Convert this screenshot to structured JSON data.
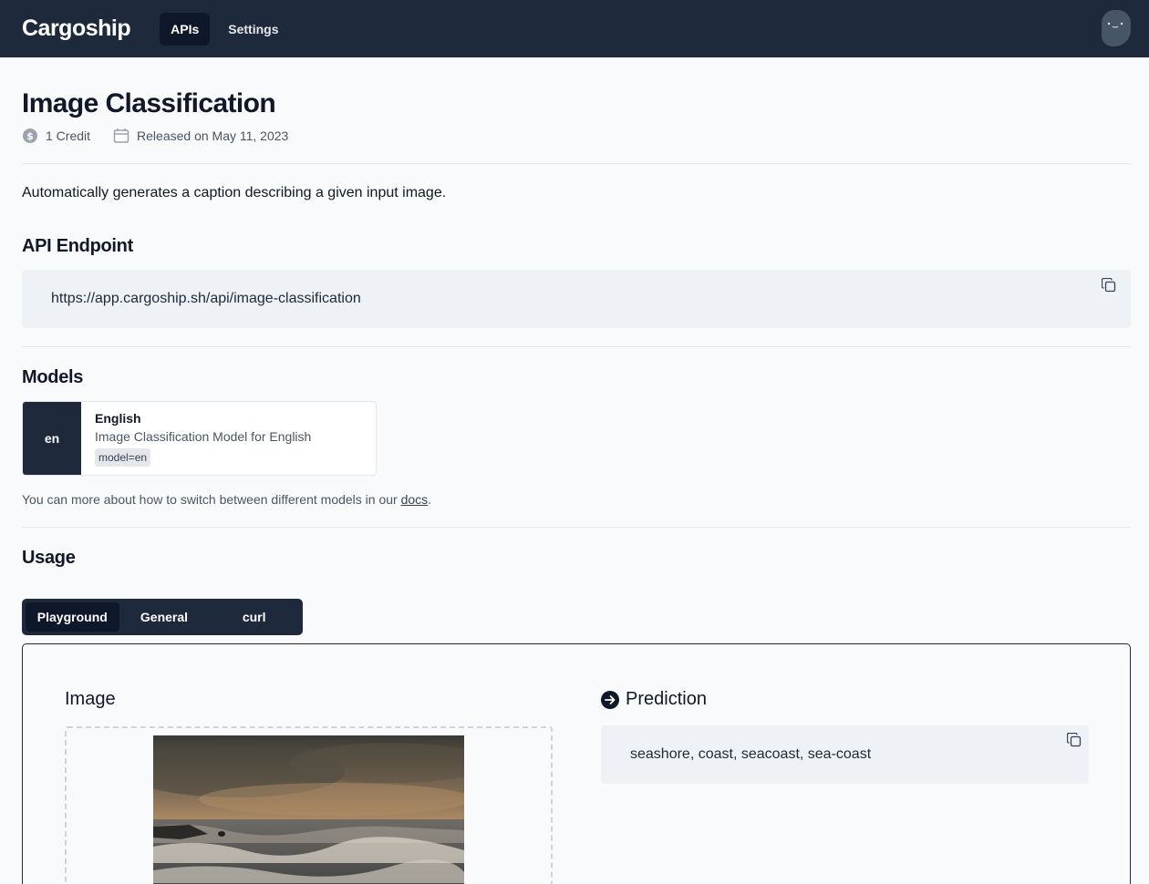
{
  "header": {
    "logo": "Cargoship",
    "nav": [
      {
        "label": "APIs",
        "active": true
      },
      {
        "label": "Settings",
        "active": false
      }
    ]
  },
  "page": {
    "title": "Image Classification",
    "credit": "1 Credit",
    "released": "Released on May 11, 2023",
    "description": "Automatically generates a caption describing a given input image."
  },
  "endpoint": {
    "heading": "API Endpoint",
    "url": "https://app.cargoship.sh/api/image-classification"
  },
  "models": {
    "heading": "Models",
    "items": [
      {
        "code": "en",
        "name": "English",
        "description": "Image Classification Model for English",
        "tag": "model=en"
      }
    ],
    "note_prefix": "You can more about how to switch between different models in our ",
    "note_link": "docs",
    "note_suffix": "."
  },
  "usage": {
    "heading": "Usage",
    "tabs": [
      {
        "label": "Playground",
        "active": true
      },
      {
        "label": "General",
        "active": false
      },
      {
        "label": "curl",
        "active": false
      }
    ]
  },
  "playground": {
    "image_label": "Image",
    "prediction_label": "Prediction",
    "prediction_value": "seashore, coast, seacoast, sea-coast"
  },
  "colors": {
    "header_bg": "#1e293b",
    "accent_dark": "#0f172a",
    "code_bg": "#eef2f7"
  },
  "icons": [
    "dollar-icon",
    "calendar-icon",
    "copy-icon",
    "arrow-right-circle-icon",
    "avatar-face-icon"
  ]
}
